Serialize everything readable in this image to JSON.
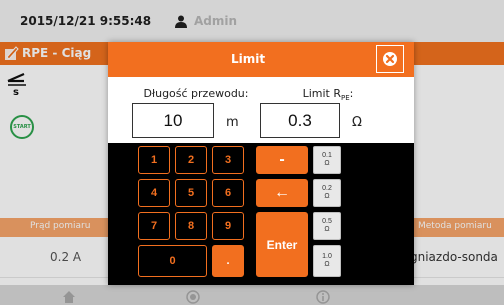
{
  "statusbar": {
    "datetime": "2015/12/21 9:55:48",
    "user_icon": "user-icon",
    "user_name": "Admin"
  },
  "app": {
    "title_icon": "r-pe-measurement-icon",
    "title": "RPE - Ciąg",
    "start_label": "START",
    "table": {
      "col_current": "Prąd pomiaru",
      "col_method": "Metoda pomiaru",
      "current_value": "0.2 A",
      "method_value": "gniazdo-sonda"
    },
    "nav_icons": [
      "home-icon",
      "record-icon",
      "info-icon"
    ]
  },
  "dialog": {
    "title": "Limit",
    "close_icon": "close-icon",
    "length_label": "Długość przewodu:",
    "length_value": "10",
    "length_unit": "m",
    "limit_label": "Limit R",
    "limit_label_sub": "PE",
    "limit_label_suffix": ":",
    "limit_value": "0.3",
    "limit_unit": "Ω"
  },
  "keypad": {
    "digits": [
      "1",
      "2",
      "3",
      "4",
      "5",
      "6",
      "7",
      "8",
      "9",
      "0",
      "."
    ],
    "minus": "-",
    "backspace": "←",
    "enter": "Enter",
    "presets": [
      {
        "value": "0.1",
        "unit": "Ω"
      },
      {
        "value": "0.2",
        "unit": "Ω"
      },
      {
        "value": "0.5",
        "unit": "Ω"
      },
      {
        "value": "1.0",
        "unit": "Ω"
      }
    ]
  },
  "colors": {
    "accent": "#f26f1f",
    "keypad_bg": "#000000",
    "start_green": "#2ea44f"
  }
}
